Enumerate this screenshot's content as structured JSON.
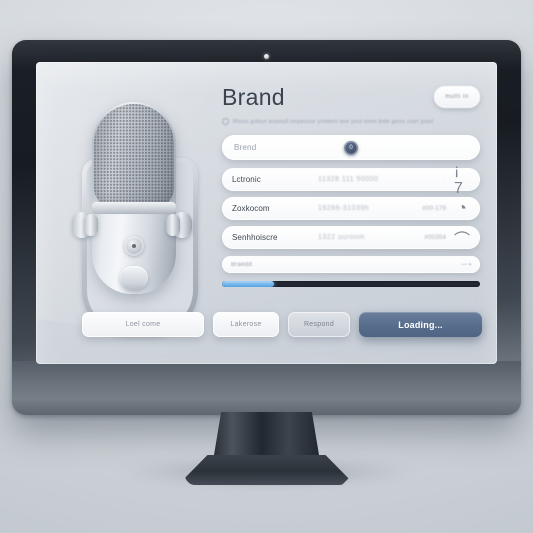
{
  "device": {
    "type": "desktop-monitor",
    "webcam": "webcam-dot"
  },
  "decor": {
    "microphone": "studio-condenser-microphone"
  },
  "panel": {
    "title": "Brand",
    "top_button_label": "multi in",
    "subtitle": "Rtuns gotiun aramult lorpecnor yriebert ave yoct snen bide jpnru ciurr josel",
    "search": {
      "placeholder": "Brend",
      "badge_icon": "info-badge-icon",
      "badge_glyph": "0"
    },
    "rows": [
      {
        "label": "Lctronic",
        "middle": "11328 111 50000",
        "value": "·",
        "icon": "list-number-icon",
        "icon_glyph": "¡ 7"
      },
      {
        "label": "Zoxkocom",
        "middle": "19286-31039h",
        "value": "#00-179",
        "icon": "pie-gauge-icon",
        "icon_glyph": "◔"
      },
      {
        "label": "Senhhoiscre",
        "middle": "1322 uuronm",
        "value": "#00354",
        "icon": "curved-check-icon",
        "icon_glyph": "⌒"
      }
    ],
    "minirow": {
      "label": "Braedd",
      "icon": "toggle-small-icon",
      "icon_glyph": "— ▪"
    },
    "progress": {
      "value": 20,
      "fill_color": "#6fb4ea",
      "track_color": "#232a35"
    }
  },
  "buttons": [
    {
      "label": "Loel come",
      "style": "white",
      "name": "loel-come-button"
    },
    {
      "label": "Lakerose",
      "style": "white2",
      "name": "lakerose-button"
    },
    {
      "label": "Respond",
      "style": "gray",
      "name": "respond-button"
    },
    {
      "label": "Loading...",
      "style": "primary",
      "name": "loading-button"
    }
  ],
  "colors": {
    "primary_button": "#566d8c",
    "screen_bg": "#d6dbe1",
    "bezel": "#1b2028",
    "accent_blue": "#6fb4ea"
  }
}
